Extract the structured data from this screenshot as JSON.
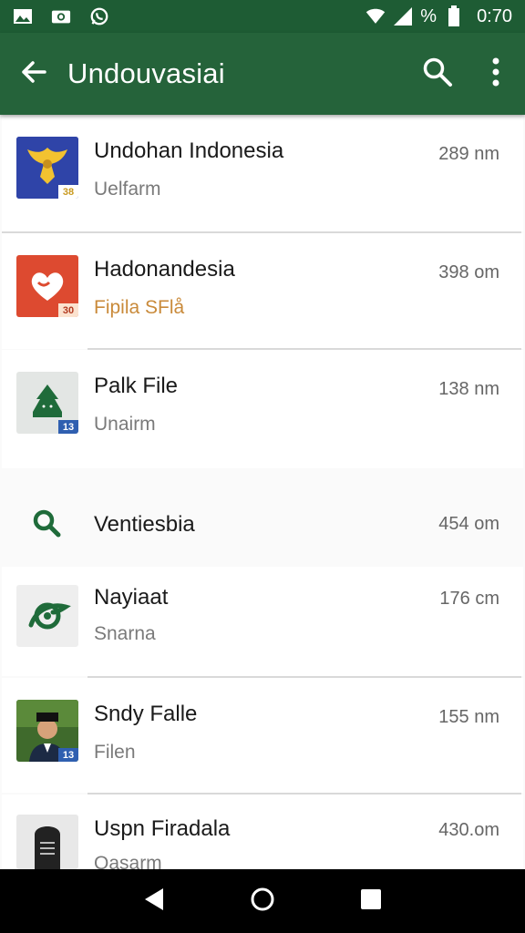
{
  "status_bar": {
    "time": "0:70",
    "icons": [
      "gallery-icon",
      "camera-icon",
      "whatsapp-icon",
      "wifi-icon",
      "signal-icon",
      "battery-icon"
    ],
    "percent_symbol": "%"
  },
  "app_bar": {
    "title": "Undouvasiai",
    "color": "#25633a"
  },
  "list": {
    "items": [
      {
        "title": "Undohan Indonesia",
        "subtitle": "Uelfarm",
        "meta": "289 nm",
        "badge": "38",
        "icon": "garuda-icon",
        "sub_color": "#7a7a7a"
      },
      {
        "title": "Hadonandesia",
        "subtitle": "Fipila SFlå",
        "meta": "398 om",
        "badge": "30",
        "icon": "hand-heart-icon",
        "sub_color": "#c98a3a"
      },
      {
        "title": "Palk File",
        "subtitle": "Unairm",
        "meta": "138 nm",
        "badge": "13",
        "icon": "mosque-icon",
        "sub_color": "#7a7a7a"
      },
      {
        "title": "Ventiesbia",
        "subtitle": "",
        "meta": "454 om",
        "badge": "",
        "icon": "search-icon",
        "sub_color": "#7a7a7a"
      },
      {
        "title": "Nayiaat",
        "subtitle": "Snarna",
        "meta": "176 cm",
        "badge": "",
        "icon": "leaf-logo-icon",
        "sub_color": "#7a7a7a"
      },
      {
        "title": "Sndy Falle",
        "subtitle": "Filen",
        "meta": "155 nm",
        "badge": "13",
        "icon": "person-photo-icon",
        "sub_color": "#7a7a7a"
      },
      {
        "title": "Uspn Firadala",
        "subtitle": "Qasarm",
        "meta": "430.om",
        "badge": "",
        "icon": "document-tablet-icon",
        "sub_color": "#7a7a7a"
      }
    ]
  },
  "nav_bar": {
    "buttons": [
      "back-triangle-icon",
      "home-circle-icon",
      "recents-square-icon"
    ]
  }
}
